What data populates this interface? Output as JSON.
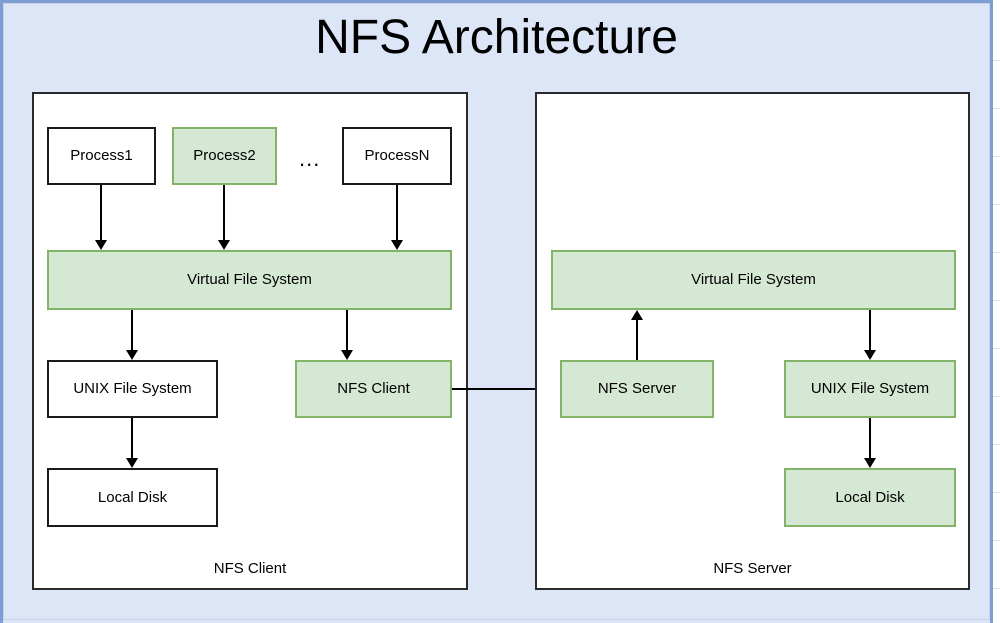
{
  "slide": {
    "title": "NFS Architecture",
    "background_color": "#dce6f7",
    "frame_color": "#7e9dd0"
  },
  "theme": {
    "green_fill": "#d5e8d4",
    "green_stroke": "#82b366",
    "white_fill": "#ffffff",
    "black_stroke": "#1a1a1a",
    "panel_stroke": "#2b2b2b",
    "text_color": "#000000"
  },
  "client_panel": {
    "label": "NFS Client",
    "nodes": {
      "process1": {
        "label": "Process1",
        "fill": "white"
      },
      "process2": {
        "label": "Process2",
        "fill": "green"
      },
      "ellipsis": {
        "label": "..."
      },
      "processN": {
        "label": "ProcessN",
        "fill": "white"
      },
      "vfs": {
        "label": "Virtual File System",
        "fill": "green"
      },
      "unix_fs": {
        "label": "UNIX File System",
        "fill": "white"
      },
      "nfs_client": {
        "label": "NFS Client",
        "fill": "green"
      },
      "local_disk": {
        "label": "Local Disk",
        "fill": "white"
      }
    }
  },
  "server_panel": {
    "label": "NFS Server",
    "nodes": {
      "vfs": {
        "label": "Virtual File System",
        "fill": "green"
      },
      "nfs_server": {
        "label": "NFS Server",
        "fill": "green"
      },
      "unix_fs": {
        "label": "UNIX File System",
        "fill": "green"
      },
      "local_disk": {
        "label": "Local Disk",
        "fill": "green"
      }
    }
  },
  "connections": [
    {
      "from": "process1",
      "to": "client-vfs",
      "direction": "down"
    },
    {
      "from": "process2",
      "to": "client-vfs",
      "direction": "down"
    },
    {
      "from": "processN",
      "to": "client-vfs",
      "direction": "down"
    },
    {
      "from": "client-vfs",
      "to": "client-unix-fs",
      "direction": "down"
    },
    {
      "from": "client-vfs",
      "to": "nfs-client",
      "direction": "down"
    },
    {
      "from": "client-unix-fs",
      "to": "client-local-disk",
      "direction": "down"
    },
    {
      "from": "nfs-client",
      "to": "nfs-server",
      "direction": "right"
    },
    {
      "from": "nfs-server",
      "to": "server-vfs",
      "direction": "up"
    },
    {
      "from": "server-vfs",
      "to": "server-unix-fs",
      "direction": "down"
    },
    {
      "from": "server-unix-fs",
      "to": "server-local-disk",
      "direction": "down"
    }
  ]
}
